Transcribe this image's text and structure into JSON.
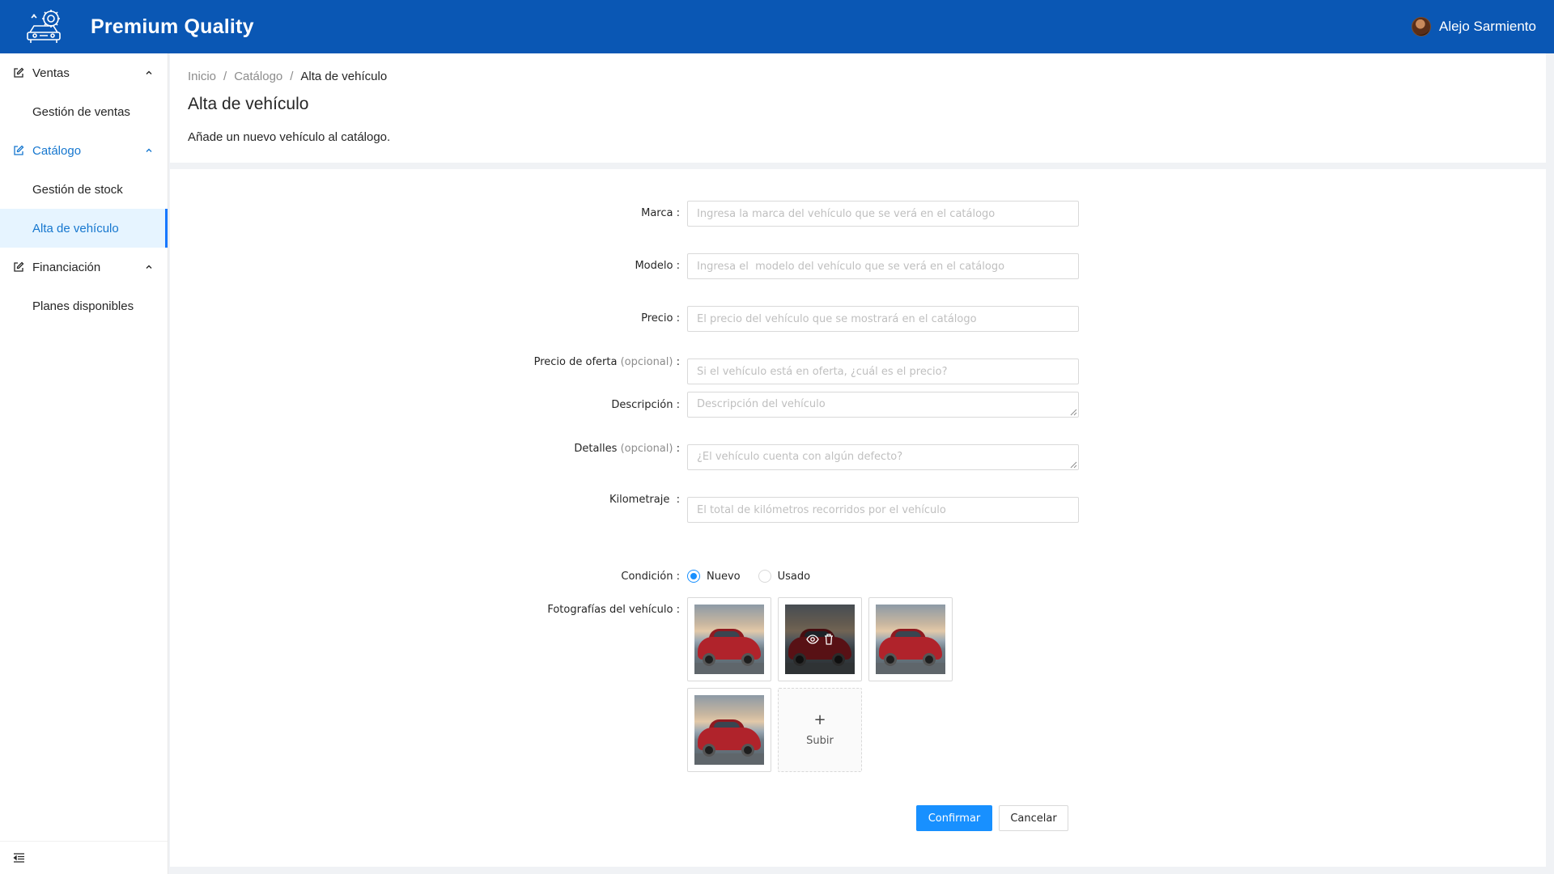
{
  "header": {
    "app_title": "Premium Quality",
    "logo_icon": "car-gear-logo-icon",
    "user_name": "Alejo Sarmiento"
  },
  "sidebar": {
    "groups": [
      {
        "label": "Ventas",
        "icon": "edit-icon",
        "expanded": true,
        "items": [
          {
            "label": "Gestión de ventas"
          }
        ]
      },
      {
        "label": "Catálogo",
        "icon": "edit-icon",
        "expanded": true,
        "active": true,
        "items": [
          {
            "label": "Gestión de stock"
          },
          {
            "label": "Alta de vehículo",
            "selected": true
          }
        ]
      },
      {
        "label": "Financiación",
        "icon": "edit-icon",
        "expanded": true,
        "items": [
          {
            "label": "Planes disponibles"
          }
        ]
      }
    ],
    "collapse_icon": "menu-fold-icon"
  },
  "breadcrumb": [
    "Inicio",
    "Catálogo",
    "Alta de vehículo"
  ],
  "page": {
    "title": "Alta de vehículo",
    "description": "Añade un nuevo vehículo al catálogo."
  },
  "form": {
    "marca": {
      "label": "Marca",
      "placeholder": "Ingresa la marca del vehículo que se verá en el catálogo"
    },
    "modelo": {
      "label": "Modelo",
      "placeholder": "Ingresa el  modelo del vehículo que se verá en el catálogo"
    },
    "precio": {
      "label": "Precio",
      "placeholder": "El precio del vehículo que se mostrará en el catálogo"
    },
    "precio_oferta": {
      "label": "Precio de oferta",
      "optional": "(opcional)",
      "placeholder": "Si el vehículo está en oferta, ¿cuál es el precio?"
    },
    "descripcion": {
      "label": "Descripción",
      "placeholder": "Descripción del vehículo"
    },
    "detalles": {
      "label": "Detalles",
      "optional": "(opcional)",
      "placeholder": "¿El vehículo cuenta con algún defecto?"
    },
    "kilometraje": {
      "label": "Kilometraje",
      "placeholder": "El total de kilómetros recorridos por el vehículo"
    },
    "condicion": {
      "label": "Condición",
      "options": [
        "Nuevo",
        "Usado"
      ],
      "selected": "Nuevo"
    },
    "fotos": {
      "label": "Fotografías del vehículo",
      "upload_label": "Subir",
      "count": 4
    },
    "colon": ":",
    "confirm_label": "Confirmar",
    "cancel_label": "Cancelar"
  },
  "colors": {
    "header": "#0a57b4",
    "primary": "#1890ff",
    "menu_active": "#1677cf"
  }
}
